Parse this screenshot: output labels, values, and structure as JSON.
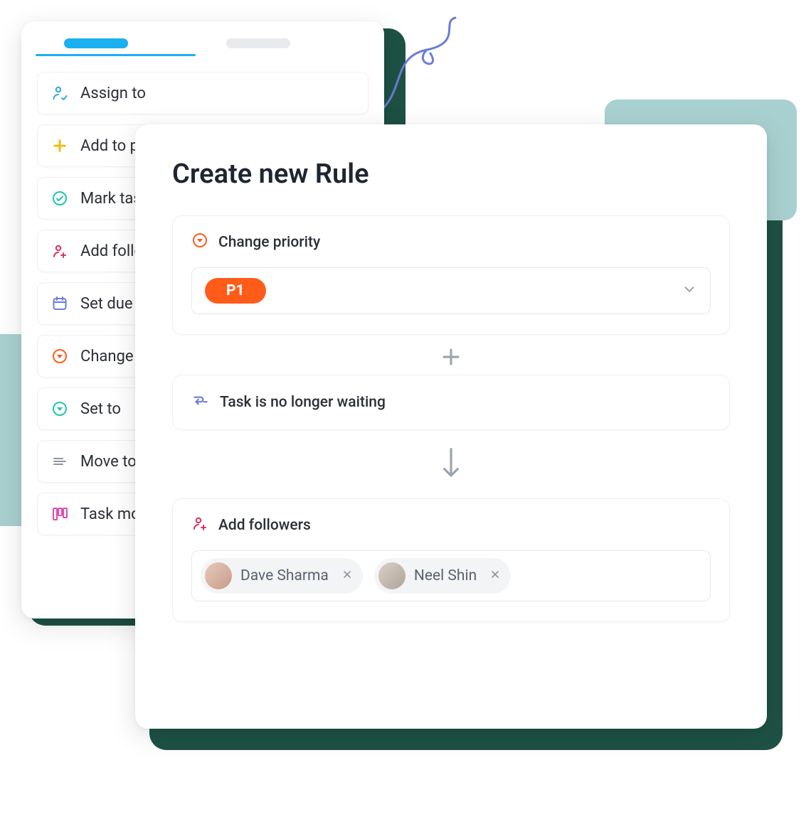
{
  "actions": [
    {
      "label": "Assign to",
      "icon": "assign"
    },
    {
      "label": "Add to p",
      "icon": "plus"
    },
    {
      "label": "Mark tas",
      "icon": "check"
    },
    {
      "label": "Add follo",
      "icon": "addfollower"
    },
    {
      "label": "Set due d",
      "icon": "calendar"
    },
    {
      "label": "Change p",
      "icon": "priority"
    },
    {
      "label": "Set to",
      "icon": "setto"
    },
    {
      "label": "Move to",
      "icon": "moveto"
    },
    {
      "label": "Task mov",
      "icon": "board"
    }
  ],
  "front": {
    "title": "Create new Rule",
    "priority_label": "Change priority",
    "priority_value": "P1",
    "waiting_label": "Task is no longer waiting",
    "followers_label": "Add followers",
    "followers": [
      {
        "name": "Dave Sharma"
      },
      {
        "name": "Neel Shin"
      }
    ]
  }
}
